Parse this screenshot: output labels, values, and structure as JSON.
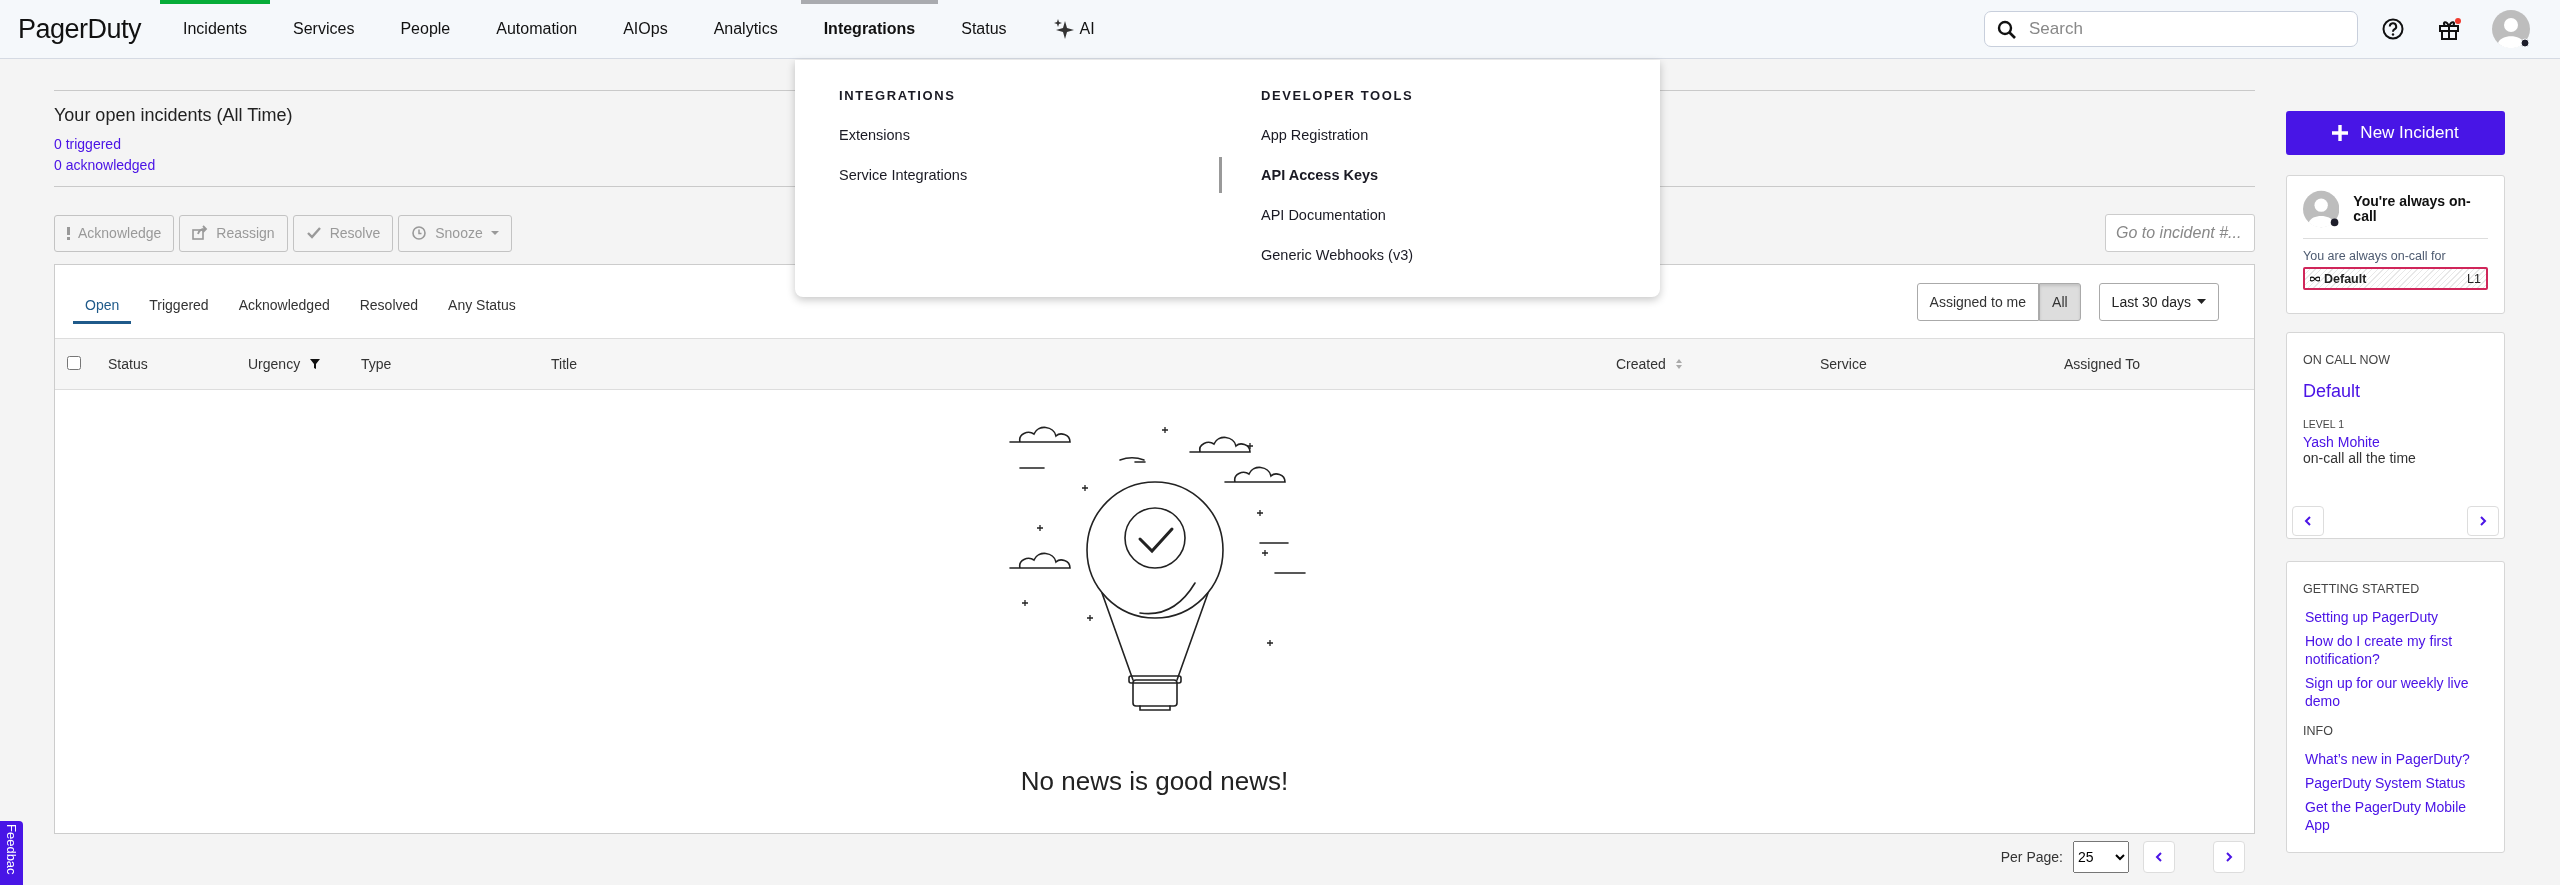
{
  "nav": {
    "logo": "PagerDuty",
    "items": [
      {
        "label": "Incidents",
        "kind": "link",
        "selected": true,
        "expanded": false
      },
      {
        "label": "Services",
        "kind": "link",
        "selected": false,
        "expanded": false
      },
      {
        "label": "People",
        "kind": "link",
        "selected": false,
        "expanded": false
      },
      {
        "label": "Automation",
        "kind": "link",
        "selected": false,
        "expanded": false
      },
      {
        "label": "AIOps",
        "kind": "link",
        "selected": false,
        "expanded": false
      },
      {
        "label": "Analytics",
        "kind": "link",
        "selected": false,
        "expanded": false
      },
      {
        "label": "Integrations",
        "kind": "link",
        "selected": false,
        "expanded": true
      },
      {
        "label": "Status",
        "kind": "link",
        "selected": false,
        "expanded": false
      },
      {
        "label": "AI",
        "kind": "ai",
        "selected": false,
        "expanded": false
      }
    ],
    "search": {
      "placeholder": "Search"
    },
    "gift_unread": true
  },
  "integrations_menu": {
    "columns": [
      {
        "heading": "INTEGRATIONS",
        "items": [
          {
            "label": "Extensions",
            "selected": false
          },
          {
            "label": "Service Integrations",
            "selected": false
          }
        ]
      },
      {
        "heading": "DEVELOPER TOOLS",
        "items": [
          {
            "label": "App Registration",
            "selected": false
          },
          {
            "label": "API Access Keys",
            "selected": true
          },
          {
            "label": "API Documentation",
            "selected": false
          },
          {
            "label": "Generic Webhooks (v3)",
            "selected": false
          }
        ]
      }
    ]
  },
  "summary": {
    "title": "Your open incidents (All Time)",
    "links": [
      "0 triggered",
      "0 acknowledged"
    ]
  },
  "actions": [
    {
      "label": "Acknowledge",
      "kind": "acknowledge",
      "disabled": true
    },
    {
      "label": "Reassign",
      "kind": "reassign",
      "disabled": true
    },
    {
      "label": "Resolve",
      "kind": "resolve",
      "disabled": true
    },
    {
      "label": "Snooze",
      "kind": "snooze",
      "disabled": true
    }
  ],
  "goto_field": {
    "placeholder": "Go to incident #..."
  },
  "status_tabs": [
    {
      "label": "Open",
      "selected": true
    },
    {
      "label": "Triggered",
      "selected": false
    },
    {
      "label": "Acknowledged",
      "selected": false
    },
    {
      "label": "Resolved",
      "selected": false
    },
    {
      "label": "Any Status",
      "selected": false
    }
  ],
  "assignee_filter": [
    {
      "label": "Assigned to me",
      "selected": false
    },
    {
      "label": "All",
      "selected": true
    }
  ],
  "date_range": "Last 30 days",
  "table": {
    "select_all_checked": false,
    "columns": [
      {
        "label": "Status",
        "kind": "plain"
      },
      {
        "label": "Urgency",
        "kind": "filter"
      },
      {
        "label": "Type",
        "kind": "plain"
      },
      {
        "label": "Title",
        "kind": "plain"
      },
      {
        "label": "Created",
        "kind": "sort"
      },
      {
        "label": "Service",
        "kind": "plain"
      },
      {
        "label": "Assigned To",
        "kind": "plain"
      }
    ],
    "empty_message": "No news is good news!"
  },
  "pagination": {
    "label": "Per Page:",
    "per_page": "25"
  },
  "new_incident_button": "New Incident",
  "on_call_card": {
    "title": "You're always on-call",
    "text": "You are always on-call for",
    "policy": "Default",
    "level": "L1"
  },
  "on_call_now": {
    "heading": "ON CALL NOW",
    "policy": "Default",
    "level_label": "LEVEL 1",
    "user": "Yash Mohite",
    "schedule": "on-call all the time"
  },
  "help": {
    "sections": [
      {
        "heading": "GETTING STARTED",
        "links": [
          "Setting up PagerDuty",
          "How do I create my first notification?",
          "Sign up for our weekly live demo"
        ]
      },
      {
        "heading": "INFO",
        "links": [
          "What’s new in PagerDuty?",
          "PagerDuty System Status",
          "Get the PagerDuty Mobile App"
        ]
      }
    ]
  },
  "feedback_tab": "Feedbac"
}
